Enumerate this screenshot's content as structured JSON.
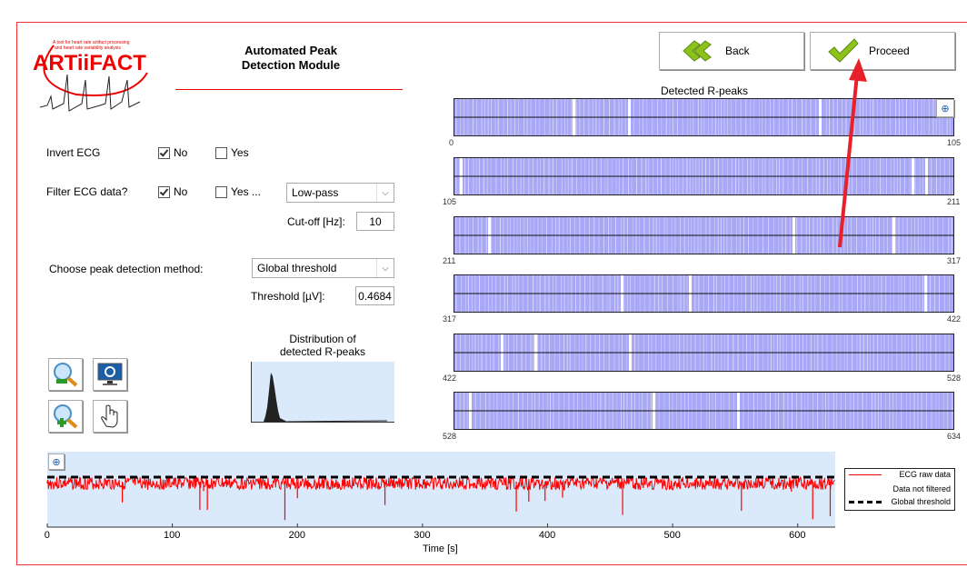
{
  "logo": {
    "text": "ARTiiFACT",
    "tagline": "A tool for heart rate artifact processing and heart rate variability analysis"
  },
  "header": {
    "title_line1": "Automated Peak",
    "title_line2": "Detection Module"
  },
  "nav": {
    "back_label": "Back",
    "proceed_label": "Proceed"
  },
  "settings": {
    "invert_label": "Invert ECG",
    "invert_no": "No",
    "invert_yes": "Yes",
    "invert_value": "No",
    "filter_label": "Filter ECG data?",
    "filter_no": "No",
    "filter_yes": "Yes ...",
    "filter_value": "No",
    "filter_type": "Low-pass",
    "cutoff_label": "Cut-off [Hz]:",
    "cutoff_value": "10",
    "method_label": "Choose peak detection method:",
    "method_value": "Global threshold",
    "threshold_label": "Threshold [µV]:",
    "threshold_value": "0.4684"
  },
  "toolbar": {
    "icons": [
      "zoom-out-icon",
      "reset-view-icon",
      "zoom-in-icon",
      "pan-hand-icon"
    ]
  },
  "histogram": {
    "title_line1": "Distribution of",
    "title_line2": "detected R-peaks"
  },
  "rpeaks": {
    "title": "Detected R-peaks",
    "strips": [
      {
        "start": "0",
        "end": "105"
      },
      {
        "start": "105",
        "end": "211"
      },
      {
        "start": "211",
        "end": "317"
      },
      {
        "start": "317",
        "end": "422"
      },
      {
        "start": "422",
        "end": "528"
      },
      {
        "start": "528",
        "end": "634"
      }
    ],
    "fill_color": "#a8a8f6"
  },
  "chart_data": {
    "type": "line",
    "xlabel": "Time [s]",
    "xlim": [
      0,
      630
    ],
    "xticks": [
      "0",
      "100",
      "200",
      "300",
      "400",
      "500",
      "600"
    ],
    "legend": {
      "placement": "right-outside",
      "entries": [
        "ECG raw data",
        "Data not filtered",
        "Global threshold"
      ]
    },
    "colors": {
      "ecg": "#ff0000",
      "threshold": "#000000",
      "background": "#dbeafb"
    }
  },
  "annotation": {
    "arrow_color": "#e8202a"
  }
}
